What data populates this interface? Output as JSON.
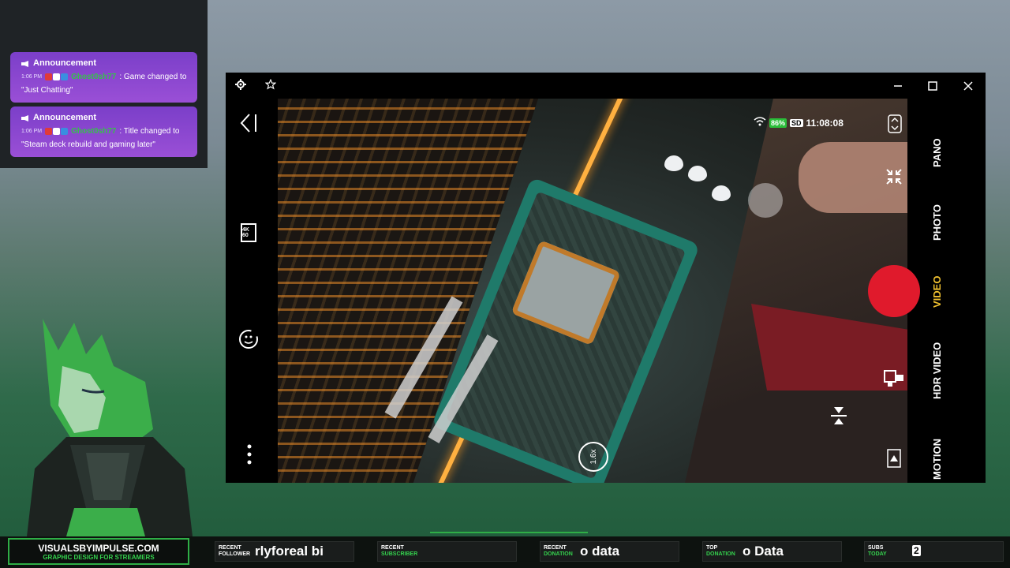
{
  "chat": {
    "announcements": [
      {
        "title": "Announcement",
        "time": "1:06 PM",
        "user": "Ghost0sh77",
        "message": ": Game changed to",
        "message2": "\"Just Chatting\""
      },
      {
        "title": "Announcement",
        "time": "1:06 PM",
        "user": "Ghost0sh77",
        "message": ": Title changed to",
        "message2": "\"Steam deck rebuild and gaming later\""
      }
    ]
  },
  "camera": {
    "battery": "86%",
    "storage": "SD",
    "clock": "11:08:08",
    "zoom": "1.6x",
    "modes": [
      "PANO",
      "PHOTO",
      "VIDEO",
      "HDR VIDEO",
      "MOTION"
    ],
    "active_mode": "VIDEO",
    "resolution_badge": "4K 60"
  },
  "overlay": {
    "brand_line1": "VISUALSBYIMPULSE.COM",
    "brand_line2": "GRAPHIC DESIGN FOR STREAMERS",
    "stats": [
      {
        "label1": "RECENT",
        "label2": "FOLLOWER",
        "value": "rlyforeal   bi"
      },
      {
        "label1": "RECENT",
        "label2": "SUBSCRIBER",
        "value": ""
      },
      {
        "label1": "RECENT",
        "label2": "DONATION",
        "value": "o data"
      },
      {
        "label1": "TOP",
        "label2": "DONATION",
        "value": "o Data"
      },
      {
        "label1": "SUBS",
        "label2": "TODAY",
        "value": "2"
      }
    ]
  }
}
